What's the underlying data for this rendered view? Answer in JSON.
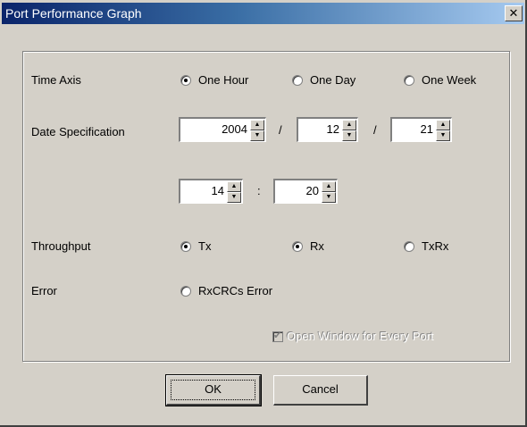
{
  "window": {
    "title": "Port Performance Graph",
    "close_glyph": "✕"
  },
  "time_axis": {
    "label": "Time Axis",
    "options": [
      "One Hour",
      "One Day",
      "One Week"
    ],
    "selected": "One Hour"
  },
  "date_spec": {
    "label": "Date Specification",
    "year": "2004",
    "month": "12",
    "day": "21",
    "hour": "14",
    "minute": "20",
    "date_sep": "/",
    "time_sep": ":"
  },
  "throughput": {
    "label": "Throughput",
    "options": [
      "Tx",
      "Rx",
      "TxRx"
    ],
    "selected": [
      "Tx",
      "Rx"
    ]
  },
  "error": {
    "label": "Error",
    "option": "RxCRCs Error",
    "selected": false
  },
  "open_window": {
    "label": "Open Window for Every Port",
    "checked": true,
    "enabled": false
  },
  "buttons": {
    "ok": "OK",
    "cancel": "Cancel"
  },
  "icons": {
    "spin_up": "up-arrow-icon",
    "spin_down": "down-arrow-icon"
  }
}
